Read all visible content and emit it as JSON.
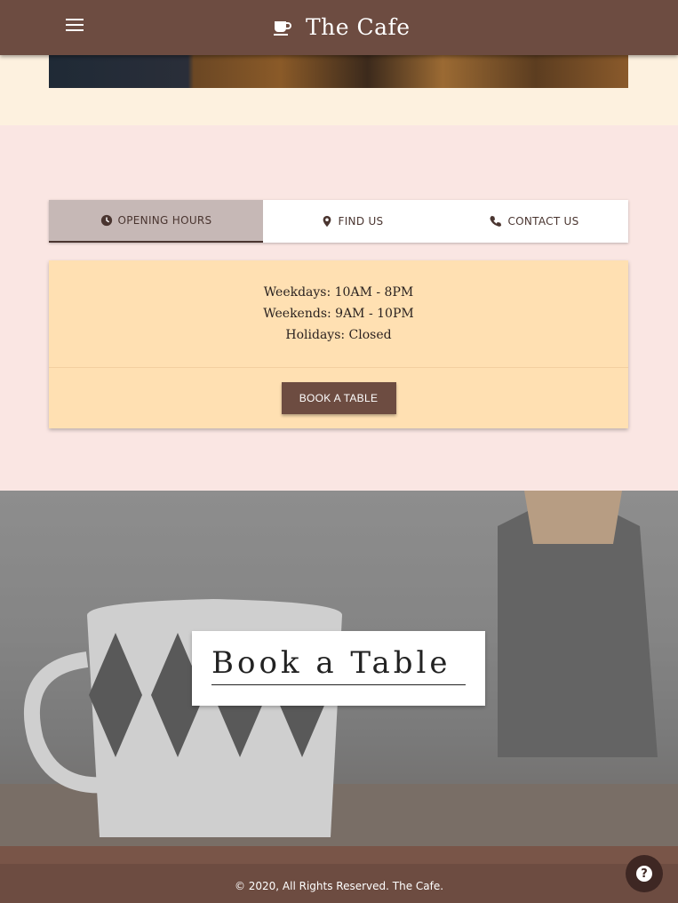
{
  "nav": {
    "brand": "The Cafe",
    "menu_icon": "menu-icon",
    "brand_icon": "coffee-cup-icon"
  },
  "tabs": [
    {
      "label": "Opening Hours",
      "icon": "clock-icon",
      "active": true
    },
    {
      "label": "Find Us",
      "icon": "map-marker-icon",
      "active": false
    },
    {
      "label": "Contact Us",
      "icon": "phone-icon",
      "active": false
    }
  ],
  "hours": {
    "weekdays": "Weekdays: 10AM - 8PM",
    "weekends": "Weekends: 9AM - 10PM",
    "holidays": "Holidays: Closed"
  },
  "card": {
    "button": "Book a Table"
  },
  "banner": {
    "title": "Book a Table"
  },
  "footer": {
    "text": "© 2020, All Rights Reserved. The Cafe."
  },
  "help": {
    "icon": "help-icon",
    "glyph": "?"
  },
  "colors": {
    "primary": "#6d4c41",
    "tab_active": "#c6b8b6",
    "card_bg": "#ffe0b2",
    "section_bg": "#fae6e3"
  }
}
